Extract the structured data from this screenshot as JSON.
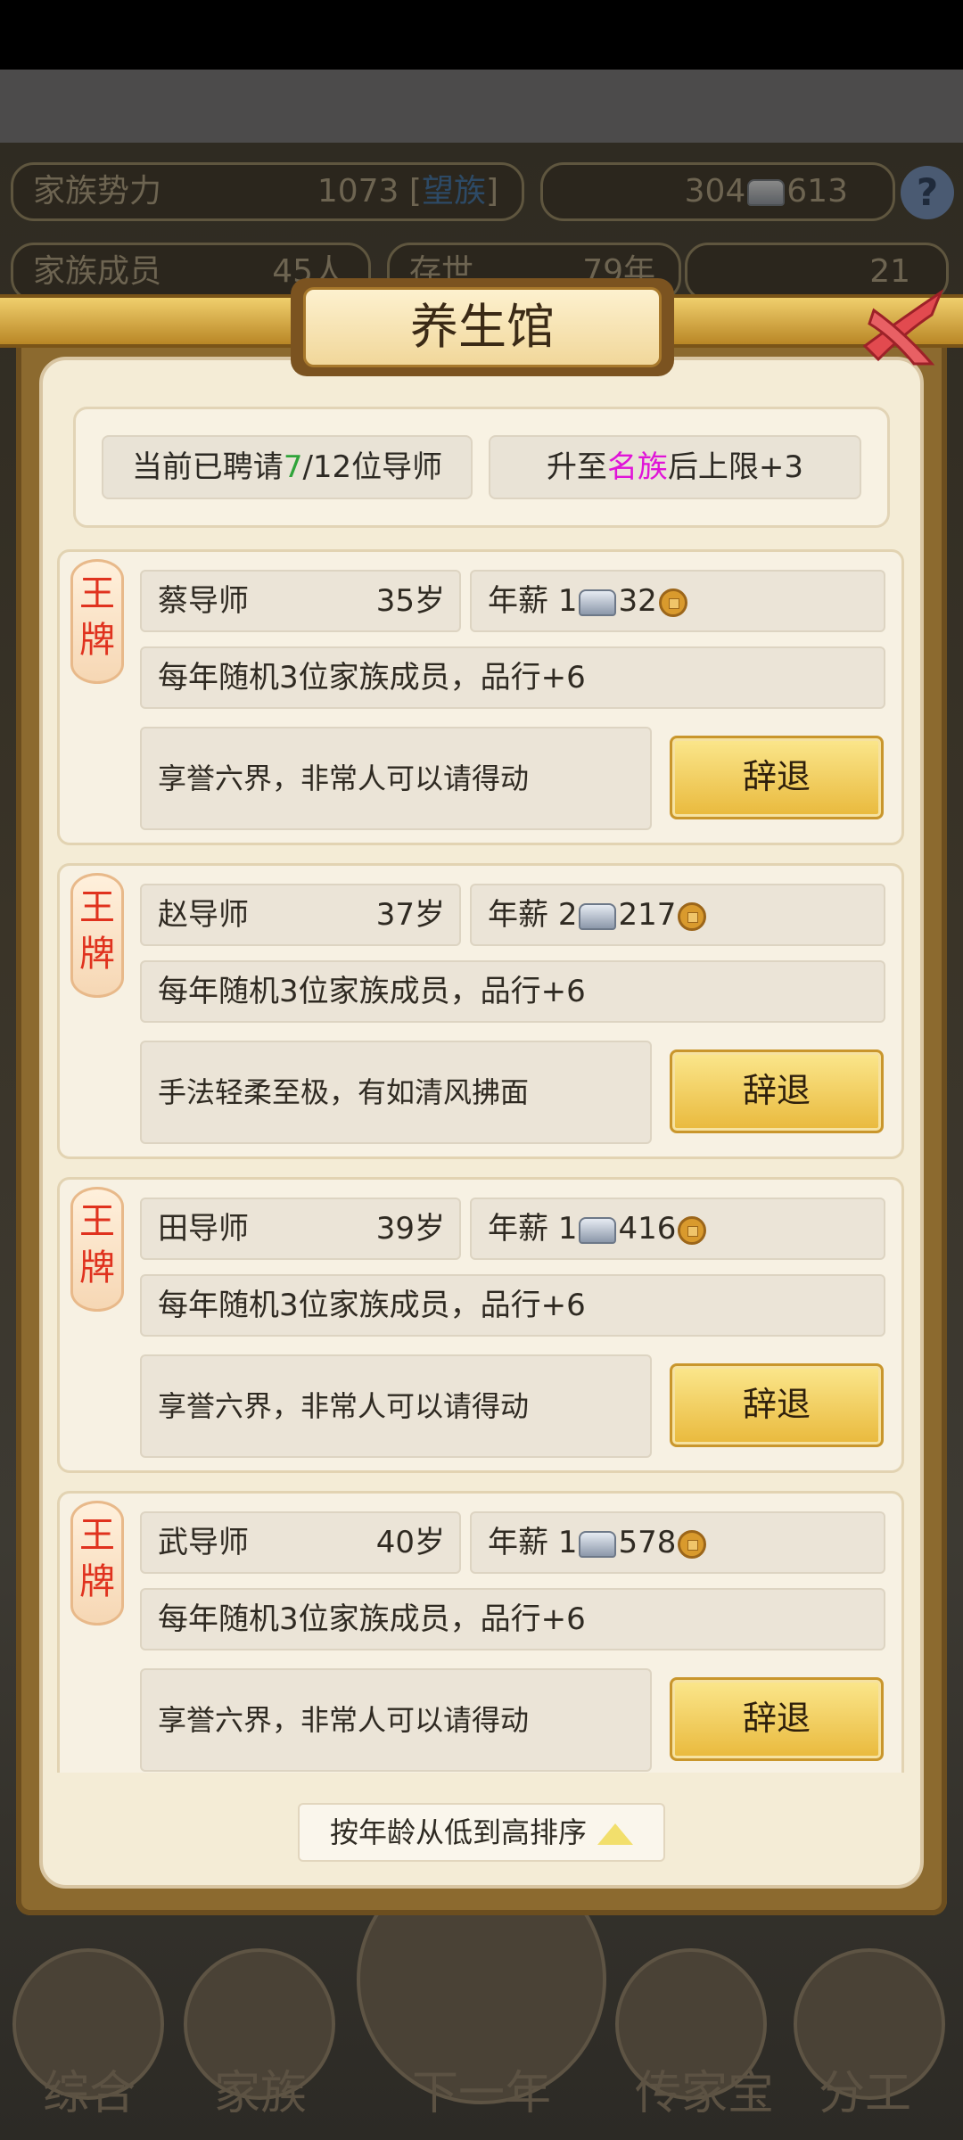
{
  "background": {
    "family_power_label": "家族势力",
    "family_power_value": "1073 [",
    "family_power_rank": "望族",
    "family_power_close": "]",
    "silver": "304",
    "copper": "613",
    "members_label": "家族成员",
    "members_value": "45人",
    "exist_label": "存世",
    "exist_value": "79年",
    "gold": "21",
    "nav": [
      "综合",
      "家族",
      "下一年",
      "传家宝",
      "分工"
    ]
  },
  "modal": {
    "title": "养生馆",
    "hired_prefix": "当前已聘请",
    "hired_count": "7",
    "hired_suffix": "/12位导师",
    "upgrade_prefix": "升至",
    "upgrade_rank": "名族",
    "upgrade_suffix": "后上限+3",
    "sort_label": "按年龄从低到高排序"
  },
  "mentors": [
    {
      "tag": "王牌",
      "name": "蔡导师",
      "age": "35岁",
      "salary_label": "年薪",
      "silver": "1",
      "copper": "32",
      "effect": "每年随机3位家族成员，品行+6",
      "desc": "享誉六界，非常人可以请得动",
      "button": "辞退"
    },
    {
      "tag": "王牌",
      "name": "赵导师",
      "age": "37岁",
      "salary_label": "年薪",
      "silver": "2",
      "copper": "217",
      "effect": "每年随机3位家族成员，品行+6",
      "desc": "手法轻柔至极，有如清风拂面",
      "button": "辞退"
    },
    {
      "tag": "王牌",
      "name": "田导师",
      "age": "39岁",
      "salary_label": "年薪",
      "silver": "1",
      "copper": "416",
      "effect": "每年随机3位家族成员，品行+6",
      "desc": "享誉六界，非常人可以请得动",
      "button": "辞退"
    },
    {
      "tag": "王牌",
      "name": "武导师",
      "age": "40岁",
      "salary_label": "年薪",
      "silver": "1",
      "copper": "578",
      "effect": "每年随机3位家族成员，品行+6",
      "desc": "享誉六界，非常人可以请得动",
      "button": "辞退"
    }
  ]
}
